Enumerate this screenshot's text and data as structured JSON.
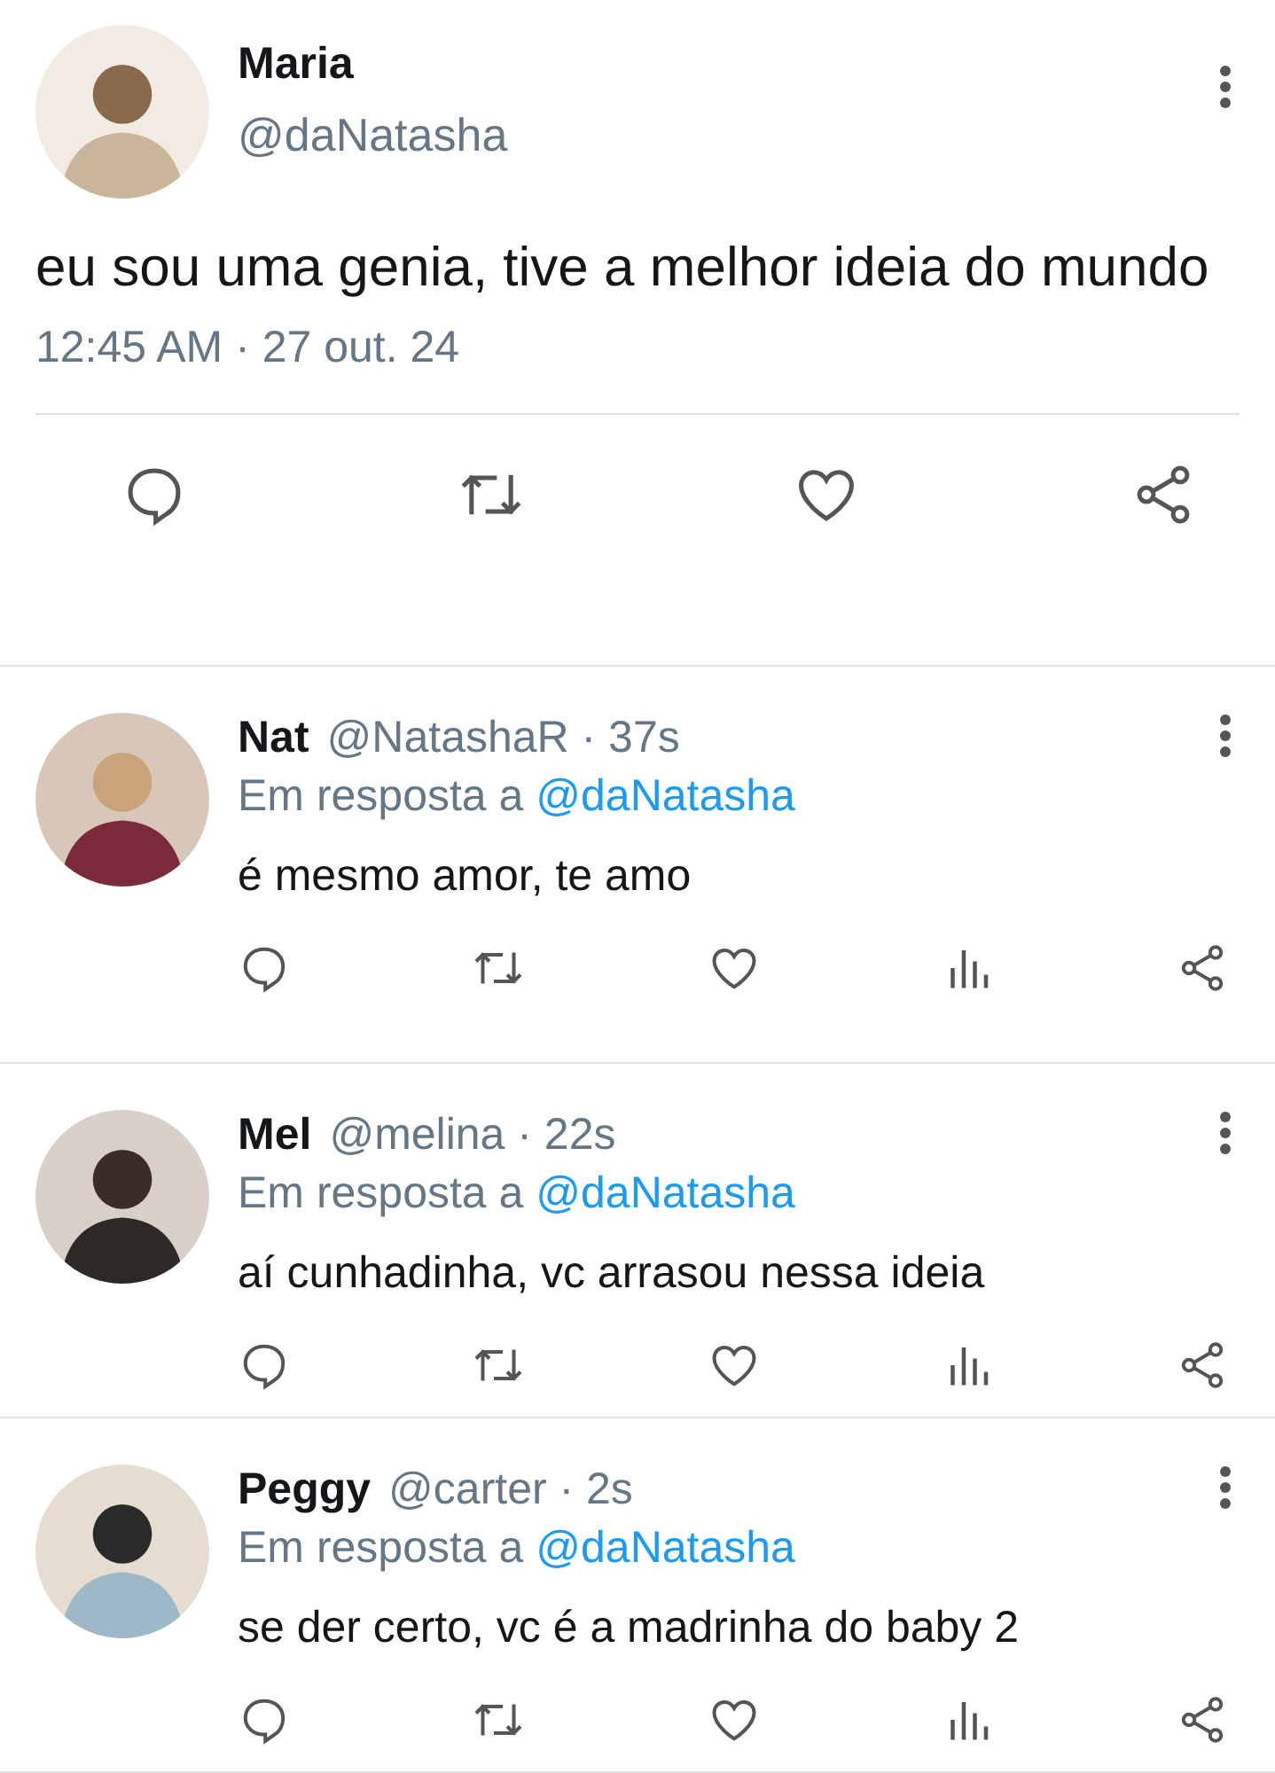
{
  "tweet": {
    "name": "Maria",
    "handle": "@daNatasha",
    "text": "eu sou uma genia, tive a melhor ideia do mundo",
    "time": "12:45 AM · 27 out. 24"
  },
  "replies": [
    {
      "name": "Nat",
      "meta": "@NatashaR · 37s",
      "reply_label": "Em resposta a",
      "reply_handle": "@daNatasha",
      "text": "é mesmo amor, te amo"
    },
    {
      "name": "Mel",
      "meta": "@melina · 22s",
      "reply_label": "Em resposta a",
      "reply_handle": "@daNatasha",
      "text": "aí cunhadinha, vc arrasou nessa ideia"
    },
    {
      "name": "Peggy",
      "meta": "@carter · 2s",
      "reply_label": "Em resposta a",
      "reply_handle": "@daNatasha",
      "text": "se der certo, vc é a madrinha do baby 2"
    }
  ]
}
